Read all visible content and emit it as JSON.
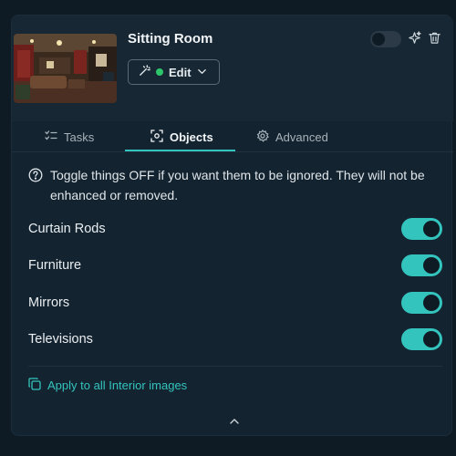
{
  "room": {
    "name": "Sitting Room",
    "edit_label": "Edit",
    "enabled": false
  },
  "tabs": [
    {
      "label": "Tasks",
      "icon": "tasks-list-icon",
      "active": false
    },
    {
      "label": "Objects",
      "icon": "object-scan-icon",
      "active": true
    },
    {
      "label": "Advanced",
      "icon": "gear-icon",
      "active": false
    }
  ],
  "info": {
    "text": "Toggle things OFF if you want them to be ignored. They will not be enhanced or removed."
  },
  "objects": [
    {
      "label": "Curtain Rods",
      "on": true
    },
    {
      "label": "Furniture",
      "on": true
    },
    {
      "label": "Mirrors",
      "on": true
    },
    {
      "label": "Televisions",
      "on": true
    }
  ],
  "apply_label": "Apply to all Interior images",
  "colors": {
    "accent": "#33c4bd",
    "status_dot": "#2ec66a",
    "background": "#0f1b24"
  }
}
